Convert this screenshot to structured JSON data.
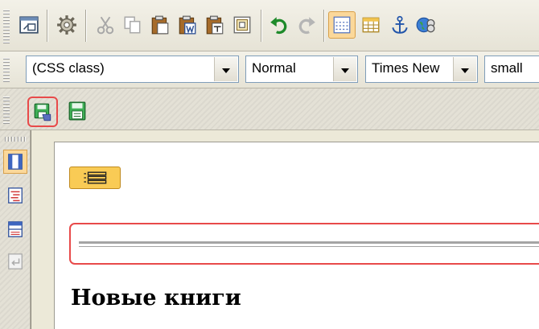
{
  "toolbar_top": {
    "buttons": [
      {
        "name": "window-button",
        "icon": "window-icon"
      },
      {
        "name": "settings-button",
        "icon": "gear-icon"
      },
      {
        "name": "cut-button",
        "icon": "scissors-icon"
      },
      {
        "name": "copy-button",
        "icon": "copy-icon"
      },
      {
        "name": "paste-button",
        "icon": "clipboard-icon"
      },
      {
        "name": "paste-from-word-button",
        "icon": "paste-word-icon"
      },
      {
        "name": "paste-text-button",
        "icon": "paste-text-icon"
      },
      {
        "name": "paste-html-button",
        "icon": "paste-html-icon"
      },
      {
        "name": "undo-button",
        "icon": "undo-arrow-icon"
      },
      {
        "name": "redo-button",
        "icon": "redo-arrow-icon"
      },
      {
        "name": "toggle-borders-button",
        "icon": "dashed-border-icon",
        "active": true
      },
      {
        "name": "insert-table-button",
        "icon": "table-icon"
      },
      {
        "name": "insert-anchor-button",
        "icon": "anchor-icon"
      },
      {
        "name": "insert-link-button",
        "icon": "globe-link-icon"
      }
    ]
  },
  "format_toolbar": {
    "css_class": "(CSS class)",
    "paragraph_format": "Normal",
    "font_name": "Times New",
    "font_size": "small"
  },
  "save_toolbar": {
    "buttons": [
      {
        "name": "save-button",
        "icon": "save-disk-icon",
        "highlighted": true
      },
      {
        "name": "save-as-button",
        "icon": "floppy-disk-icon"
      }
    ]
  },
  "left_sidebar": {
    "buttons": [
      {
        "name": "design-view-button",
        "icon": "design-view-icon",
        "active": true
      },
      {
        "name": "html-view-button",
        "icon": "html-source-icon"
      },
      {
        "name": "split-view-button",
        "icon": "split-view-icon"
      },
      {
        "name": "preview-button",
        "icon": "preview-icon",
        "disabled": true
      }
    ]
  },
  "editor": {
    "heading": "Новые книги"
  },
  "colors": {
    "toolbar_bg": "#ece9d8",
    "active_button_bg": "#fbd89a",
    "active_button_border": "#d8a04a",
    "highlight_red": "#e84a4a",
    "div_badge": "#f9cb55"
  }
}
